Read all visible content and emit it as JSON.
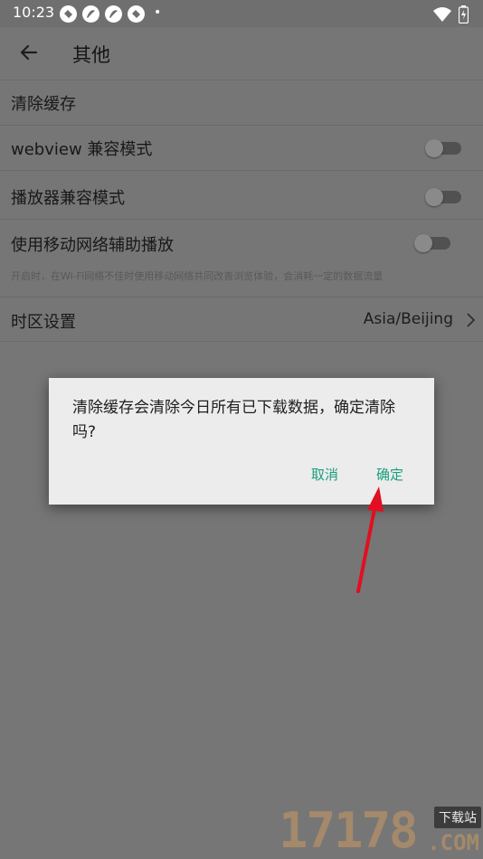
{
  "status_bar": {
    "time": "10:23",
    "notification_icons": [
      "vpn-key-icon",
      "app-notification-icon",
      "app-notification-icon",
      "vpn-key-icon"
    ],
    "more_dot": "•",
    "right_icons": [
      "wifi-icon",
      "battery-charging-icon"
    ]
  },
  "app_bar": {
    "back_icon": "arrow-left-icon",
    "title": "其他"
  },
  "settings": {
    "clear_cache": {
      "label": "清除缓存"
    },
    "webview_compat": {
      "label": "webview 兼容模式",
      "enabled": false
    },
    "player_compat": {
      "label": "播放器兼容模式",
      "enabled": false
    },
    "mobile_assist": {
      "label": "使用移动网络辅助播放",
      "description": "开启时，在Wi-Fi网络不佳时使用移动网络共同改善浏览体验，会消耗一定的数据流量",
      "enabled": false
    },
    "timezone": {
      "label": "时区设置",
      "value": "Asia/Beijing",
      "chevron_icon": "chevron-right-icon"
    }
  },
  "dialog": {
    "message": "清除缓存会清除今日所有已下载数据，确定清除吗?",
    "cancel_label": "取消",
    "confirm_label": "确定"
  },
  "watermark": {
    "number": "17178",
    "badge": "下载站",
    "domain": ".COM"
  },
  "colors": {
    "dim_background": "#767676",
    "dialog_background": "#ececec",
    "accent": "#1a9e80",
    "annotation_arrow": "#e01020"
  }
}
